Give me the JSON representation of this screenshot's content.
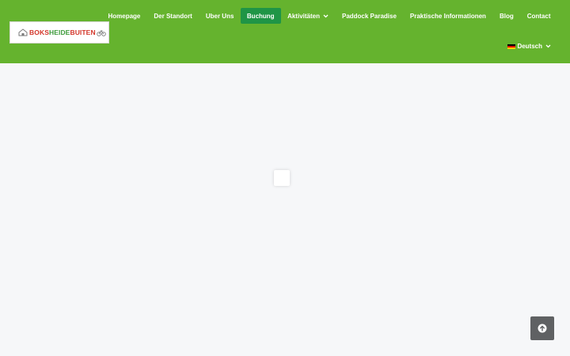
{
  "header": {
    "background": "#65b32e",
    "logo": {
      "part1": "BOKS",
      "part2": "HEIDE",
      "part3": "BUITEN",
      "icon_left": "cabin-icon",
      "icon_right": "bicycle-icon"
    }
  },
  "nav": {
    "items": [
      {
        "label": "Homepage",
        "active": false,
        "dropdown": false
      },
      {
        "label": "Der Standort",
        "active": false,
        "dropdown": false
      },
      {
        "label": "Uber Uns",
        "active": false,
        "dropdown": false
      },
      {
        "label": "Buchung",
        "active": true,
        "dropdown": false
      },
      {
        "label": "Aktivitäten",
        "active": false,
        "dropdown": true
      },
      {
        "label": "Paddock Paradise",
        "active": false,
        "dropdown": false
      },
      {
        "label": "Praktische Informationen",
        "active": false,
        "dropdown": false
      },
      {
        "label": "Blog",
        "active": false,
        "dropdown": false
      },
      {
        "label": "Contact",
        "active": false,
        "dropdown": false
      }
    ],
    "active_color": "#1f9546"
  },
  "language": {
    "label": "Deutsch",
    "flag_icon": "german-flag-icon"
  },
  "main": {
    "background": "#f6f7f9",
    "loader_icon": "loading-spinner-icon"
  },
  "back_to_top": {
    "icon": "arrow-up-circle-icon",
    "background": "#5f6163"
  }
}
